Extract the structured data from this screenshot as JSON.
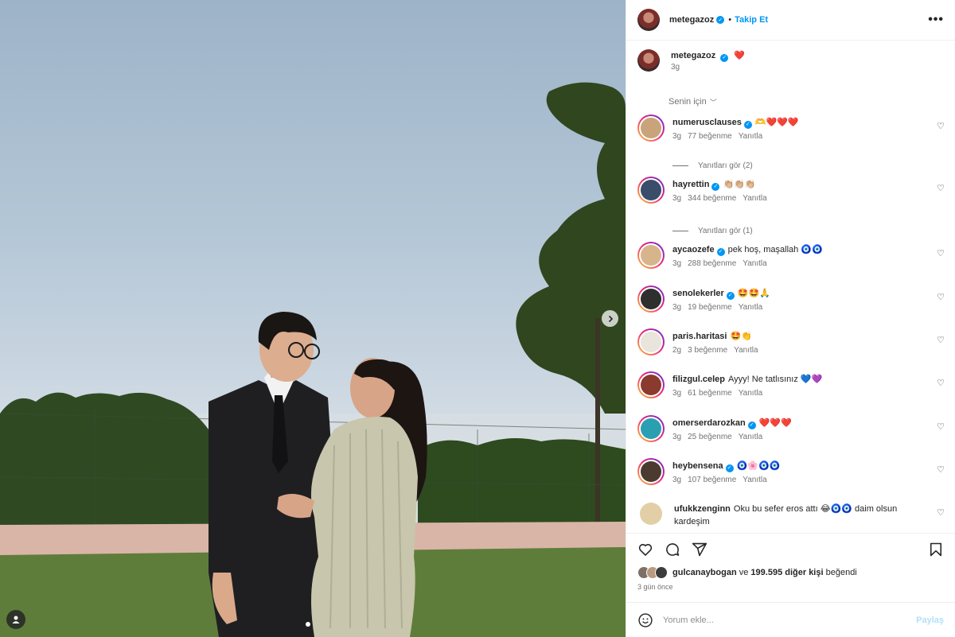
{
  "post": {
    "author": "metegazoz",
    "follow_label": "Takip Et",
    "dot": "•",
    "more_label": "•••",
    "caption": {
      "username": "metegazoz",
      "text": "❤️",
      "time": "3g"
    },
    "sort_label": "Senin için",
    "sort_chevron": "﹀"
  },
  "comments": [
    {
      "username": "numerusclauses",
      "verified": true,
      "text": "🫶❤️❤️❤️",
      "time": "3g",
      "likes": "77 beğenme",
      "reply": "Yanıtla",
      "view_replies": "Yanıtları gör (2)",
      "color": "#c9a37a"
    },
    {
      "username": "hayrettin",
      "verified": true,
      "text": "👏🏼👏🏼👏🏼",
      "time": "3g",
      "likes": "344 beğenme",
      "reply": "Yanıtla",
      "view_replies": "Yanıtları gör (1)",
      "color": "#3a4d6b"
    },
    {
      "username": "aycaozefe",
      "verified": true,
      "text": "pek hoş, maşallah 🧿🧿",
      "time": "3g",
      "likes": "288 beğenme",
      "reply": "Yanıtla",
      "color": "#d8b48c"
    },
    {
      "username": "senolekerler",
      "verified": true,
      "text": "🤩🤩🙏",
      "time": "3g",
      "likes": "19 beğenme",
      "reply": "Yanıtla",
      "color": "#2f2f2f"
    },
    {
      "username": "paris.haritasi",
      "verified": false,
      "text": "🤩👏",
      "time": "2g",
      "likes": "3 beğenme",
      "reply": "Yanıtla",
      "color": "#e9e4dc"
    },
    {
      "username": "filizgul.celep",
      "verified": false,
      "text": "Ayyy! Ne tatlısınız 💙💜",
      "time": "3g",
      "likes": "61 beğenme",
      "reply": "Yanıtla",
      "color": "#8a3b2e"
    },
    {
      "username": "omerserdarozkan",
      "verified": true,
      "text": "❤️❤️❤️",
      "time": "3g",
      "likes": "25 beğenme",
      "reply": "Yanıtla",
      "color": "#2a9fb2"
    },
    {
      "username": "heybensena",
      "verified": true,
      "text": "🧿🌸🧿🧿",
      "time": "3g",
      "likes": "107 beğenme",
      "reply": "Yanıtla",
      "color": "#4a3a30"
    },
    {
      "username": "ufukkzenginn",
      "verified": false,
      "text": "Oku bu sefer eros attı 😂🧿🧿 daim olsun",
      "text2": "kardeşim",
      "color": "#e2cfa8"
    }
  ],
  "footer": {
    "liked_by_user": "gulcanaybogan",
    "liked_by_mid": " ve ",
    "liked_by_others": "199.595 diğer kişi",
    "liked_by_end": " beğendi",
    "date": "3 gün önce",
    "comment_placeholder": "Yorum ekle...",
    "share_label": "Paylaş"
  },
  "colors": {
    "accent": "#0095f6",
    "text": "#262626",
    "muted": "#737373",
    "border": "#efefef"
  },
  "icons": [
    "heart-icon",
    "comment-icon",
    "share-icon",
    "bookmark-icon",
    "emoji-icon",
    "more-icon",
    "verified-icon",
    "chevron-right-icon",
    "user-tag-icon"
  ]
}
